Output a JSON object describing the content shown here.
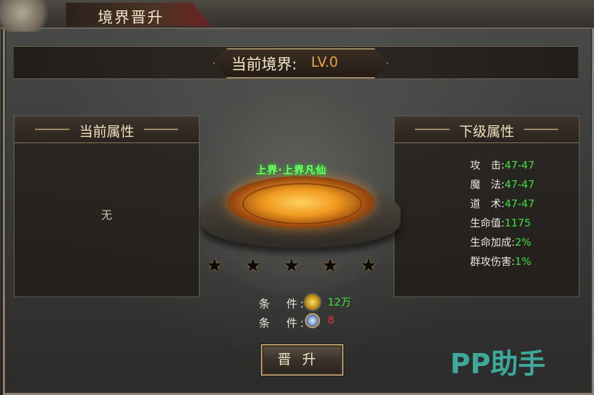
{
  "window": {
    "title": "境界晋升"
  },
  "realm": {
    "label": "当前境界:",
    "value": "LV.0"
  },
  "left_panel": {
    "title": "当前属性",
    "empty_text": "无"
  },
  "right_panel": {
    "title": "下级属性",
    "attributes": [
      {
        "name": "攻　击:",
        "value": "47-47"
      },
      {
        "name": "魔　法:",
        "value": "47-47"
      },
      {
        "name": "道　术:",
        "value": "47-47"
      },
      {
        "name": "生命值:",
        "value": "1175"
      },
      {
        "name": "生命加成:",
        "value": "2%"
      },
      {
        "name": "群攻伤害:",
        "value": "1%"
      }
    ]
  },
  "realm_title_art": "上界·上界凡仙",
  "stars": {
    "total": 5,
    "filled": 0
  },
  "conditions": [
    {
      "label": "条　件:",
      "icon": "gold-coin-icon",
      "value": "12万",
      "color": "#3be23b"
    },
    {
      "label": "条　件:",
      "icon": "jade-medal-icon",
      "value": "8",
      "color": "#e83030"
    }
  ],
  "promote_button": {
    "label": "晋升"
  },
  "watermark": "PP助手",
  "colors": {
    "green_value": "#39e23a",
    "orange_level": "#f0a040",
    "red_value": "#e83030",
    "panel_text": "#efdfbf"
  }
}
